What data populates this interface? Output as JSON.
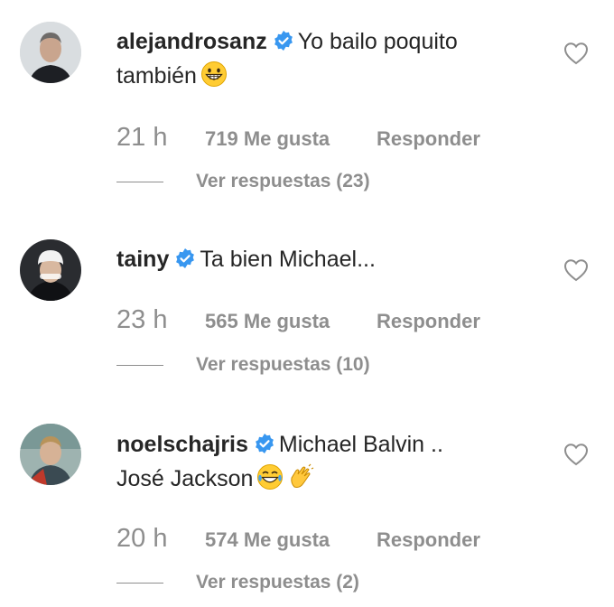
{
  "comments": [
    {
      "username": "alejandrosanz",
      "text_line1": "Yo bailo poquito",
      "text_line2": "también",
      "emojis": [
        "grinning-face-emoji"
      ],
      "time": "21 h",
      "likes": "719 Me gusta",
      "reply": "Responder",
      "view_replies": "Ver respuestas (23)"
    },
    {
      "username": "tainy",
      "text_line1": "Ta bien Michael...",
      "text_line2": "",
      "emojis": [],
      "time": "23 h",
      "likes": "565 Me gusta",
      "reply": "Responder",
      "view_replies": "Ver respuestas (10)"
    },
    {
      "username": "noelschajris",
      "text_line1": "Michael Balvin ..",
      "text_line2": "José Jackson",
      "emojis": [
        "tears-of-joy-emoji",
        "clapping-hands-emoji"
      ],
      "time": "20 h",
      "likes": "574 Me gusta",
      "reply": "Responder",
      "view_replies": "Ver respuestas (2)"
    }
  ],
  "icons": {
    "verified": "verified-badge-icon",
    "like": "heart-outline-icon"
  },
  "colors": {
    "verified_blue": "#3897f0",
    "meta_gray": "#8e8e8e",
    "text": "#262626"
  }
}
